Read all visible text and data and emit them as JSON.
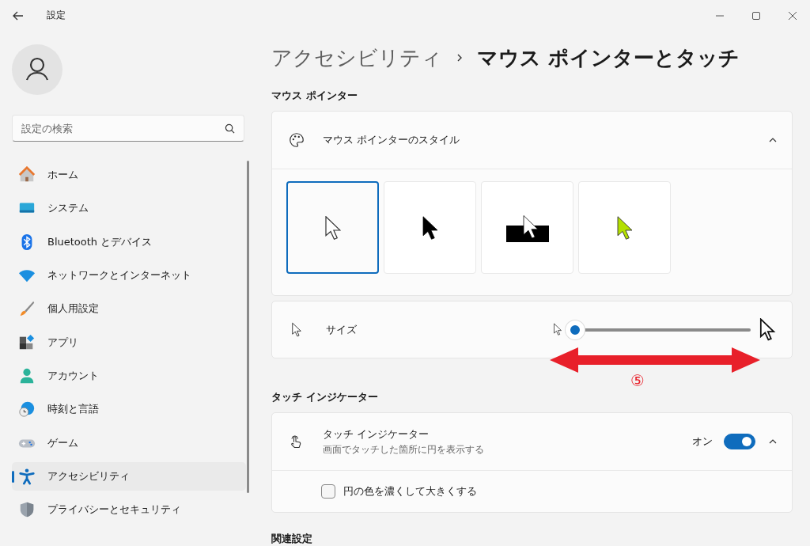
{
  "window": {
    "title": "設定"
  },
  "sidebar": {
    "search": {
      "placeholder": "設定の検索"
    },
    "items": [
      {
        "label": "ホーム",
        "selected": false
      },
      {
        "label": "システム",
        "selected": false
      },
      {
        "label": "Bluetooth とデバイス",
        "selected": false
      },
      {
        "label": "ネットワークとインターネット",
        "selected": false
      },
      {
        "label": "個人用設定",
        "selected": false
      },
      {
        "label": "アプリ",
        "selected": false
      },
      {
        "label": "アカウント",
        "selected": false
      },
      {
        "label": "時刻と言語",
        "selected": false
      },
      {
        "label": "ゲーム",
        "selected": false
      },
      {
        "label": "アクセシビリティ",
        "selected": true
      },
      {
        "label": "プライバシーとセキュリティ",
        "selected": false
      }
    ]
  },
  "breadcrumb": [
    "アクセシビリティ",
    "マウス ポインターとタッチ"
  ],
  "mouse_pointer": {
    "heading": "マウス ポインター",
    "style": {
      "label": "マウス ポインターのスタイル",
      "expanded": true,
      "options": [
        {
          "kind": "white",
          "selected": true
        },
        {
          "kind": "black",
          "selected": false
        },
        {
          "kind": "inverted",
          "selected": false
        },
        {
          "kind": "custom",
          "color": "#b4e000",
          "selected": false
        }
      ]
    },
    "size": {
      "label": "サイズ",
      "level": 0
    }
  },
  "annotation": {
    "label": "⑤"
  },
  "touch": {
    "heading": "タッチ インジケーター",
    "title": "タッチ インジケーター",
    "description": "画面でタッチした箇所に円を表示する",
    "state_label": "オン",
    "on": true,
    "expanded": true,
    "option": {
      "label": "円の色を濃くして大きくする",
      "checked": false
    }
  },
  "related": {
    "heading": "関連設定"
  }
}
